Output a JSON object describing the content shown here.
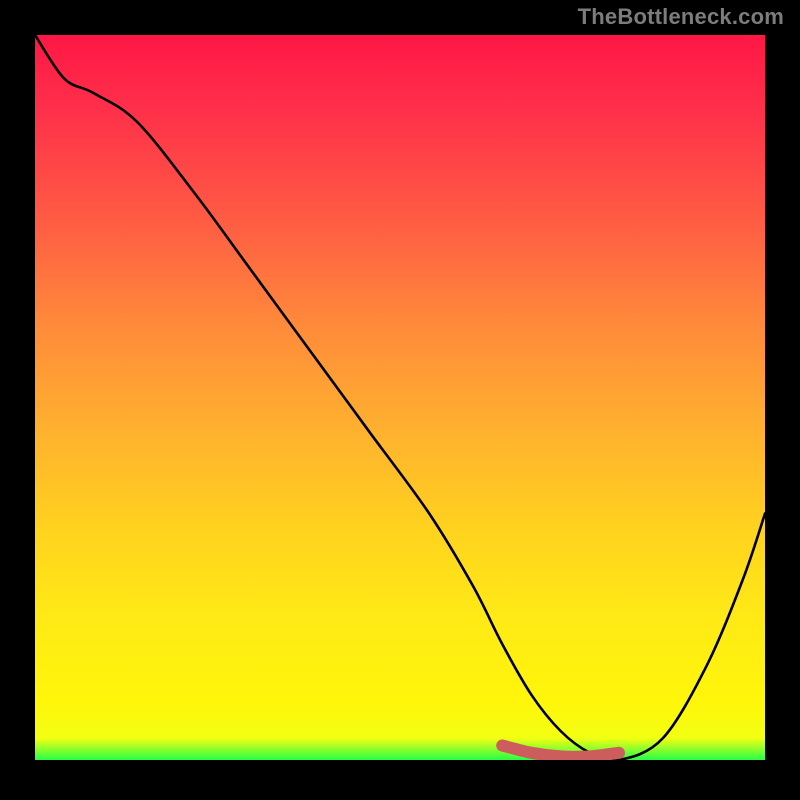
{
  "watermark": "TheBottleneck.com",
  "colors": {
    "background": "#000000",
    "gradient_top": "#ff1745",
    "gradient_mid": "#ffd21e",
    "gradient_bottom": "#27ff46",
    "curve": "#000000",
    "accent": "#cd5c5c"
  },
  "chart_data": {
    "type": "line",
    "title": "",
    "xlabel": "",
    "ylabel": "",
    "xlim": [
      0,
      100
    ],
    "ylim": [
      0,
      100
    ],
    "grid": false,
    "legend": false,
    "series": [
      {
        "name": "curve",
        "x": [
          0,
          4,
          8,
          14,
          22,
          30,
          38,
          46,
          54,
          60,
          64,
          68,
          72,
          76,
          80,
          86,
          92,
          97,
          100
        ],
        "values": [
          100,
          94,
          92,
          88,
          78,
          67,
          56,
          45,
          34,
          24,
          16,
          9,
          4,
          1,
          0,
          3,
          13,
          25,
          34
        ]
      },
      {
        "name": "optimal-range",
        "x": [
          64,
          68,
          72,
          76,
          80
        ],
        "values": [
          2,
          1,
          0.5,
          0.5,
          1
        ]
      }
    ],
    "annotations": []
  }
}
